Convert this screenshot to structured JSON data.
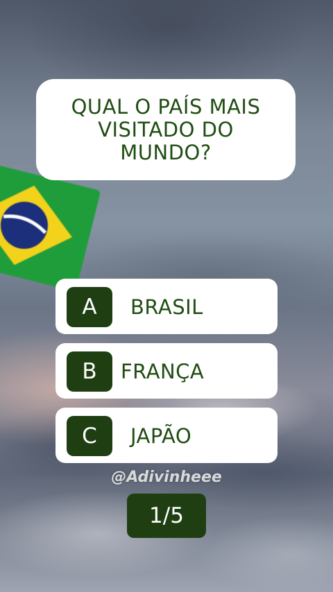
{
  "question": {
    "text": "QUAL O PAÍS MAIS VISITADO DO MUNDO?"
  },
  "options": [
    {
      "letter": "A",
      "label": "BRASIL"
    },
    {
      "letter": "B",
      "label": "FRANÇA"
    },
    {
      "letter": "C",
      "label": "JAPÃO"
    }
  ],
  "watermark": "@Adivinheee",
  "counter": "1/5",
  "colors": {
    "dark_green": "#1f3f13",
    "text_green": "#1f4d12",
    "card_white": "#ffffff"
  }
}
